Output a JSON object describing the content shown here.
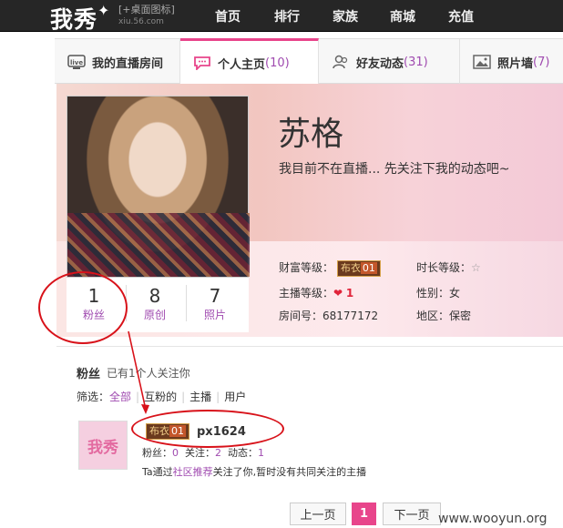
{
  "topbar": {
    "logo": "我秀",
    "logo_sub": "[+桌面图标]",
    "logo_url": "xiu.56.com",
    "nav": [
      "首页",
      "排行",
      "家族",
      "商城",
      "充值"
    ]
  },
  "tabs": [
    {
      "label": "我的直播房间",
      "count": ""
    },
    {
      "label": "个人主页",
      "count": "(10)"
    },
    {
      "label": "好友动态",
      "count": "(31)"
    },
    {
      "label": "照片墙",
      "count": "(7)"
    }
  ],
  "profile": {
    "name": "苏格",
    "motto": "我目前不在直播... 先关注下我的动态吧~",
    "stats": [
      {
        "num": "1",
        "label": "粉丝"
      },
      {
        "num": "8",
        "label": "原创"
      },
      {
        "num": "7",
        "label": "照片"
      }
    ],
    "wealth_label": "财富等级：",
    "wealth_badge": "布衣",
    "wealth_badge_lv": "01",
    "duration_label": "时长等级：",
    "host_label": "主播等级：",
    "host_level": "1",
    "gender_label": "性别：",
    "gender": "女",
    "room_label": "房间号：",
    "room": "68177172",
    "region_label": "地区：",
    "region": "保密"
  },
  "fans": {
    "title": "粉丝",
    "desc": "已有1个人关注你",
    "filter_label": "筛选：",
    "filters": [
      "全部",
      "互粉的",
      "主播",
      "用户"
    ],
    "item": {
      "avatar_text": "我秀",
      "badge": "布衣",
      "badge_lv": "01",
      "username": "px1624",
      "fans_label": "粉丝：",
      "fans": "0",
      "follow_label": "关注：",
      "follow": "2",
      "dyn_label": "动态：",
      "dyn": "1",
      "note_pre": "Ta通过",
      "note_link": "社区推荐",
      "note_post": "关注了你,暂时没有共同关注的主播"
    }
  },
  "pager": {
    "prev": "上一页",
    "current": "1",
    "next": "下一页"
  },
  "watermark": "www.wooyun.org",
  "colors": {
    "accent": "#e8458b",
    "link": "#a04bb0",
    "annotation": "#d8121a"
  }
}
